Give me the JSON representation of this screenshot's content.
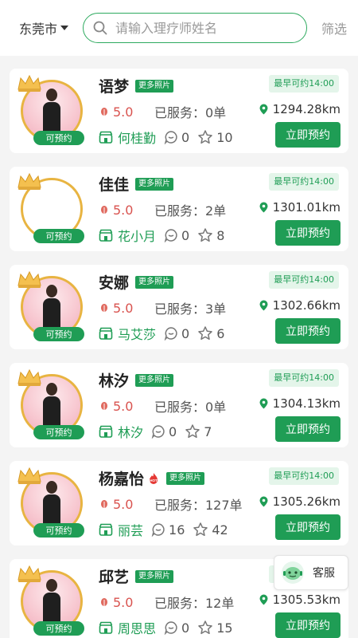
{
  "header": {
    "city": "东莞市",
    "search_placeholder": "请输入理疗师姓名",
    "filter_label": "筛选"
  },
  "labels": {
    "available": "可预约",
    "more_photos": "更多照片",
    "served_prefix": "已服务：",
    "book_button": "立即预约"
  },
  "therapists": [
    {
      "name": "语梦",
      "hot": false,
      "rating": "5.0",
      "served": "0单",
      "earliest": "最早可约14:00",
      "distance": "1294.28km",
      "shop": "何桂勤",
      "comments": "0",
      "favorites": "10",
      "has_photo": true
    },
    {
      "name": "佳佳",
      "hot": false,
      "rating": "5.0",
      "served": "2单",
      "earliest": "最早可约14:00",
      "distance": "1301.01km",
      "shop": "花小月",
      "comments": "0",
      "favorites": "8",
      "has_photo": false
    },
    {
      "name": "安娜",
      "hot": false,
      "rating": "5.0",
      "served": "3单",
      "earliest": "最早可约14:00",
      "distance": "1302.66km",
      "shop": "马艾莎",
      "comments": "0",
      "favorites": "6",
      "has_photo": true
    },
    {
      "name": "林汐",
      "hot": false,
      "rating": "5.0",
      "served": "0单",
      "earliest": "最早可约14:00",
      "distance": "1304.13km",
      "shop": "林汐",
      "comments": "0",
      "favorites": "7",
      "has_photo": true
    },
    {
      "name": "杨嘉怡",
      "hot": true,
      "rating": "5.0",
      "served": "127单",
      "earliest": "最早可约14:00",
      "distance": "1305.26km",
      "shop": "丽芸",
      "comments": "16",
      "favorites": "42",
      "has_photo": true
    },
    {
      "name": "邱艺",
      "hot": false,
      "rating": "5.0",
      "served": "12单",
      "earliest": "最早可约14:00",
      "distance": "1305.53km",
      "shop": "周思思",
      "comments": "0",
      "favorites": "15",
      "has_photo": true
    }
  ],
  "service": {
    "label": "客服"
  },
  "colors": {
    "accent": "#1f9d55",
    "rating": "#d9534f",
    "gold": "#e8b441"
  }
}
